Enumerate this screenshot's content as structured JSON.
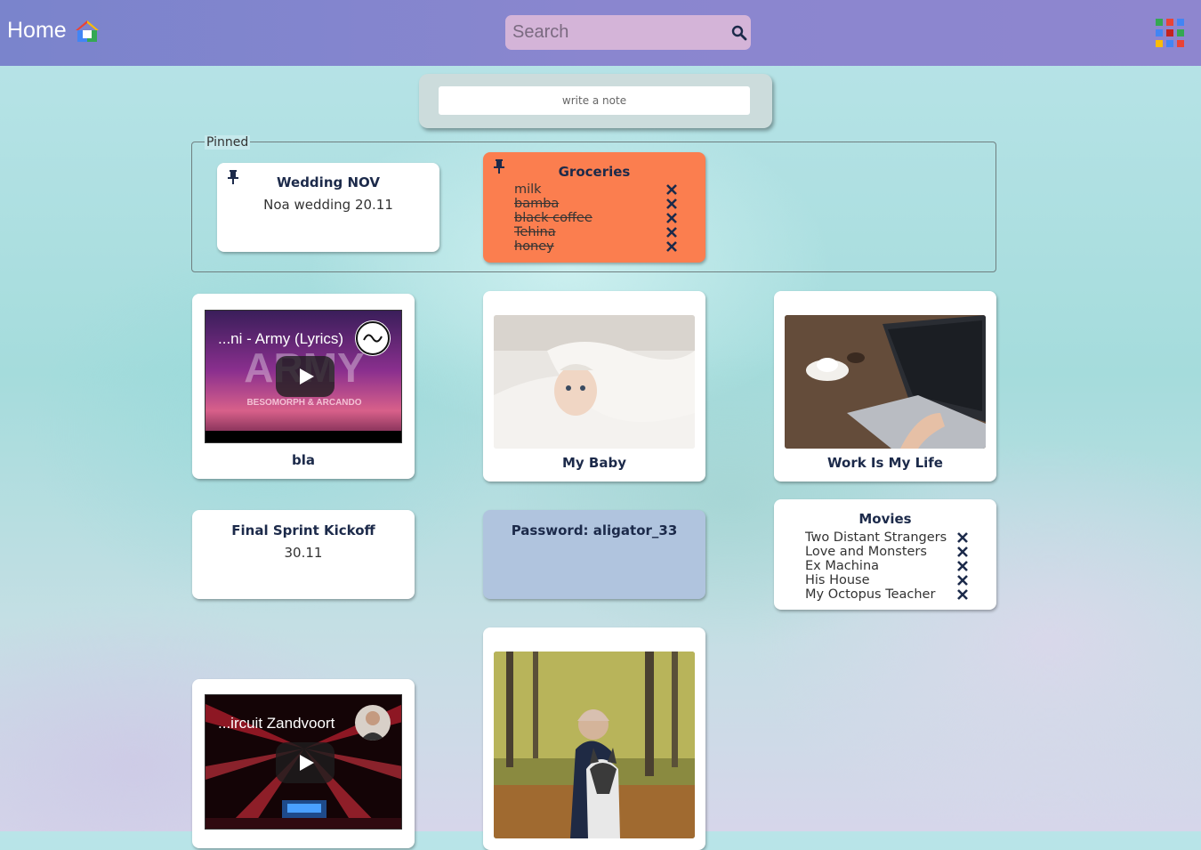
{
  "header": {
    "title": "Home",
    "search_placeholder": "Search"
  },
  "composer": {
    "placeholder": "write a note"
  },
  "pinned": {
    "legend": "Pinned",
    "notes": [
      {
        "title": "Wedding NOV",
        "text": "Noa wedding 20.11",
        "color": "#ffffff"
      },
      {
        "title": "Groceries",
        "color": "#fb7e4f",
        "todos": [
          {
            "text": "milk",
            "done": false
          },
          {
            "text": "bamba",
            "done": true
          },
          {
            "text": "black coffee",
            "done": true
          },
          {
            "text": "Tehina",
            "done": true
          },
          {
            "text": "honey",
            "done": true
          }
        ]
      }
    ]
  },
  "notes": {
    "video1": {
      "video_title": "...ni - Army (Lyrics)",
      "caption": "bla"
    },
    "baby": {
      "caption": "My Baby"
    },
    "work": {
      "caption": "Work Is My Life"
    },
    "sprint": {
      "title": "Final Sprint Kickoff",
      "text": "30.11"
    },
    "password": {
      "title": "Password: aligator_33",
      "color": "#b0c4de"
    },
    "movies": {
      "title": "Movies",
      "todos": [
        {
          "text": "Two Distant Strangers"
        },
        {
          "text": "Love and Monsters"
        },
        {
          "text": "Ex Machina"
        },
        {
          "text": "His House"
        },
        {
          "text": "My Octopus Teacher"
        }
      ]
    },
    "video2": {
      "video_title": "...ircuit Zandvoort"
    }
  },
  "colors": {
    "header": "#8a86cf",
    "search_bg": "#d4b4d8",
    "text_dark": "#1c2a4a"
  },
  "icons": [
    "home-logo-icon",
    "search-icon",
    "apps-grid-icon",
    "pin-icon",
    "remove-x-icon",
    "play-icon"
  ]
}
